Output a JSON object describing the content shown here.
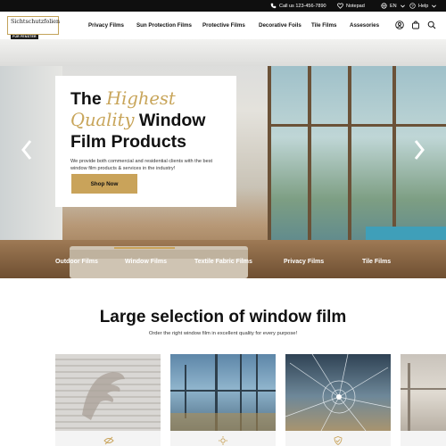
{
  "topbar": {
    "phone": "Call us 123-456-7890",
    "notepad": "Notepad",
    "language": "EN",
    "help": "Help"
  },
  "logo": {
    "line1": "Sichtschutzfolien",
    "line2": "FÜR FENSTER"
  },
  "nav": {
    "items": [
      "Privacy Films",
      "Sun Protection Films",
      "Protective Films",
      "Decorative Foils",
      "Tile Films",
      "Assesories"
    ]
  },
  "header_icons": [
    "user-icon",
    "cart-icon",
    "search-icon"
  ],
  "hero": {
    "title_the": "The",
    "title_highest": "Highest",
    "title_quality": "Quality",
    "title_window": "Window",
    "title_line3": "Film Products",
    "description": "We provide both commercial and residential clients with the best window film products & services in the industry!",
    "button": "Shop Now",
    "categories": [
      "Outdoor Films",
      "Window Films",
      "Textile Fabric Films",
      "Privacy Films",
      "Tile Films"
    ],
    "active_category": "Window Films",
    "accent_color": "#c9a35a"
  },
  "section": {
    "title": "Large selection of window film",
    "subtitle": "Order the right window film in excellent quality for every purpose!"
  },
  "products": [
    {
      "icon": "privacy-icon"
    },
    {
      "icon": "sun-icon"
    },
    {
      "icon": "shield-icon"
    },
    {
      "icon": "decor-icon"
    }
  ]
}
